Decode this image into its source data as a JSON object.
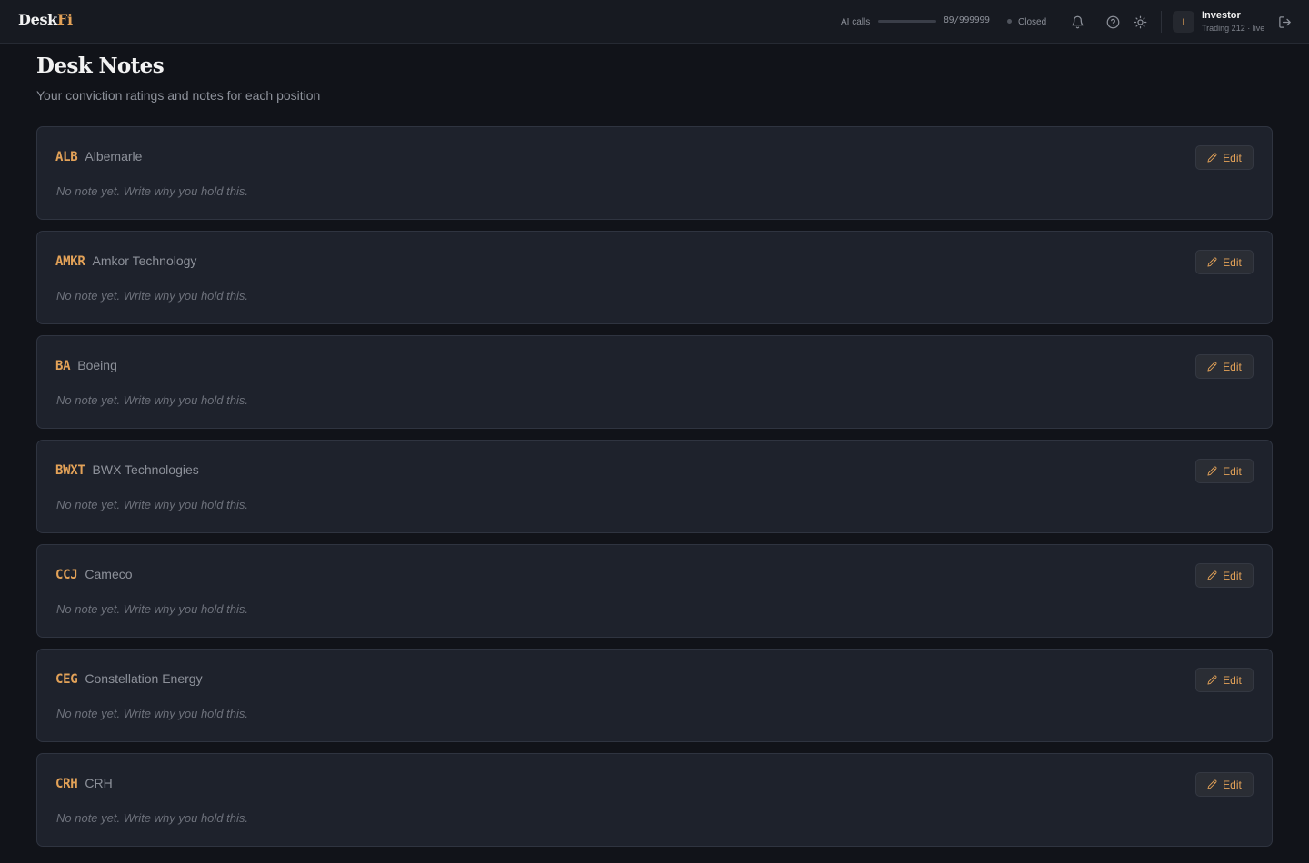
{
  "app": {
    "logo_main": "Desk",
    "logo_accent": "Fi"
  },
  "header": {
    "ai_calls_label": "AI calls",
    "ai_calls_count": "89/999999",
    "ai_calls_fraction": 0.0001,
    "market_status": "Closed",
    "icons": [
      "bell-icon",
      "help-icon",
      "sun-icon",
      "logout-icon"
    ],
    "avatar_initial": "I",
    "user_name": "Investor",
    "user_sub": "Trading 212 · live"
  },
  "page": {
    "title": "Desk Notes",
    "subtitle": "Your conviction ratings and notes for each position"
  },
  "colors": {
    "accent": "#e3a258",
    "background": "#111319",
    "card": "#1e222c"
  },
  "positions": [
    {
      "ticker": "ALB",
      "name": "Albemarle",
      "note": "No note yet. Write why you hold this.",
      "edit_label": "Edit"
    },
    {
      "ticker": "AMKR",
      "name": "Amkor Technology",
      "note": "No note yet. Write why you hold this.",
      "edit_label": "Edit"
    },
    {
      "ticker": "BA",
      "name": "Boeing",
      "note": "No note yet. Write why you hold this.",
      "edit_label": "Edit"
    },
    {
      "ticker": "BWXT",
      "name": "BWX Technologies",
      "note": "No note yet. Write why you hold this.",
      "edit_label": "Edit"
    },
    {
      "ticker": "CCJ",
      "name": "Cameco",
      "note": "No note yet. Write why you hold this.",
      "edit_label": "Edit"
    },
    {
      "ticker": "CEG",
      "name": "Constellation Energy",
      "note": "No note yet. Write why you hold this.",
      "edit_label": "Edit"
    },
    {
      "ticker": "CRH",
      "name": "CRH",
      "note": "No note yet. Write why you hold this.",
      "edit_label": "Edit"
    }
  ]
}
